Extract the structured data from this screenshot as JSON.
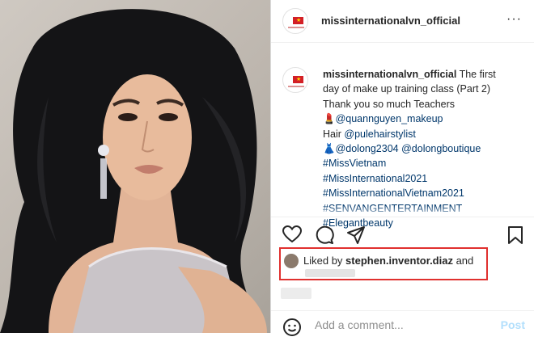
{
  "post": {
    "username": "missinternationalvn_official",
    "more_label": "···"
  },
  "caption": {
    "username": "missinternationalvn_official",
    "intro": " The first",
    "line2": "day of make up training class (Part 2)",
    "line3": "Thank you so much Teachers",
    "line4_emoji": "💄",
    "line4_mention": "@quannguyen_makeup",
    "line5_text": "Hair ",
    "line5_mention": "@pulehairstylist",
    "line6_emoji": "👗",
    "line6_mention1": "@dolong2304",
    "line6_mention2": "@dolongboutique",
    "hashtag1": "#MissVietnam",
    "hashtag2": "#MissInternational2021",
    "hashtag3": "#MissInternationalVietnam2021",
    "hashtag4": "#SENVANGENTERTAINMENT",
    "hashtag5": "#Elegantbeauty"
  },
  "actions": {
    "like_icon": "heart-icon",
    "comment_icon": "comment-icon",
    "share_icon": "send-icon",
    "save_icon": "bookmark-icon"
  },
  "likes": {
    "prefix": "Liked by ",
    "user": "stephen.inventor.diaz",
    "suffix": " and"
  },
  "comment_box": {
    "placeholder": "Add a comment...",
    "post_label": "Post",
    "emoji_icon": "smiley-icon"
  },
  "colors": {
    "highlight_border": "#e0302e",
    "link": "#00376b",
    "post_disabled": "#b2dffc"
  }
}
